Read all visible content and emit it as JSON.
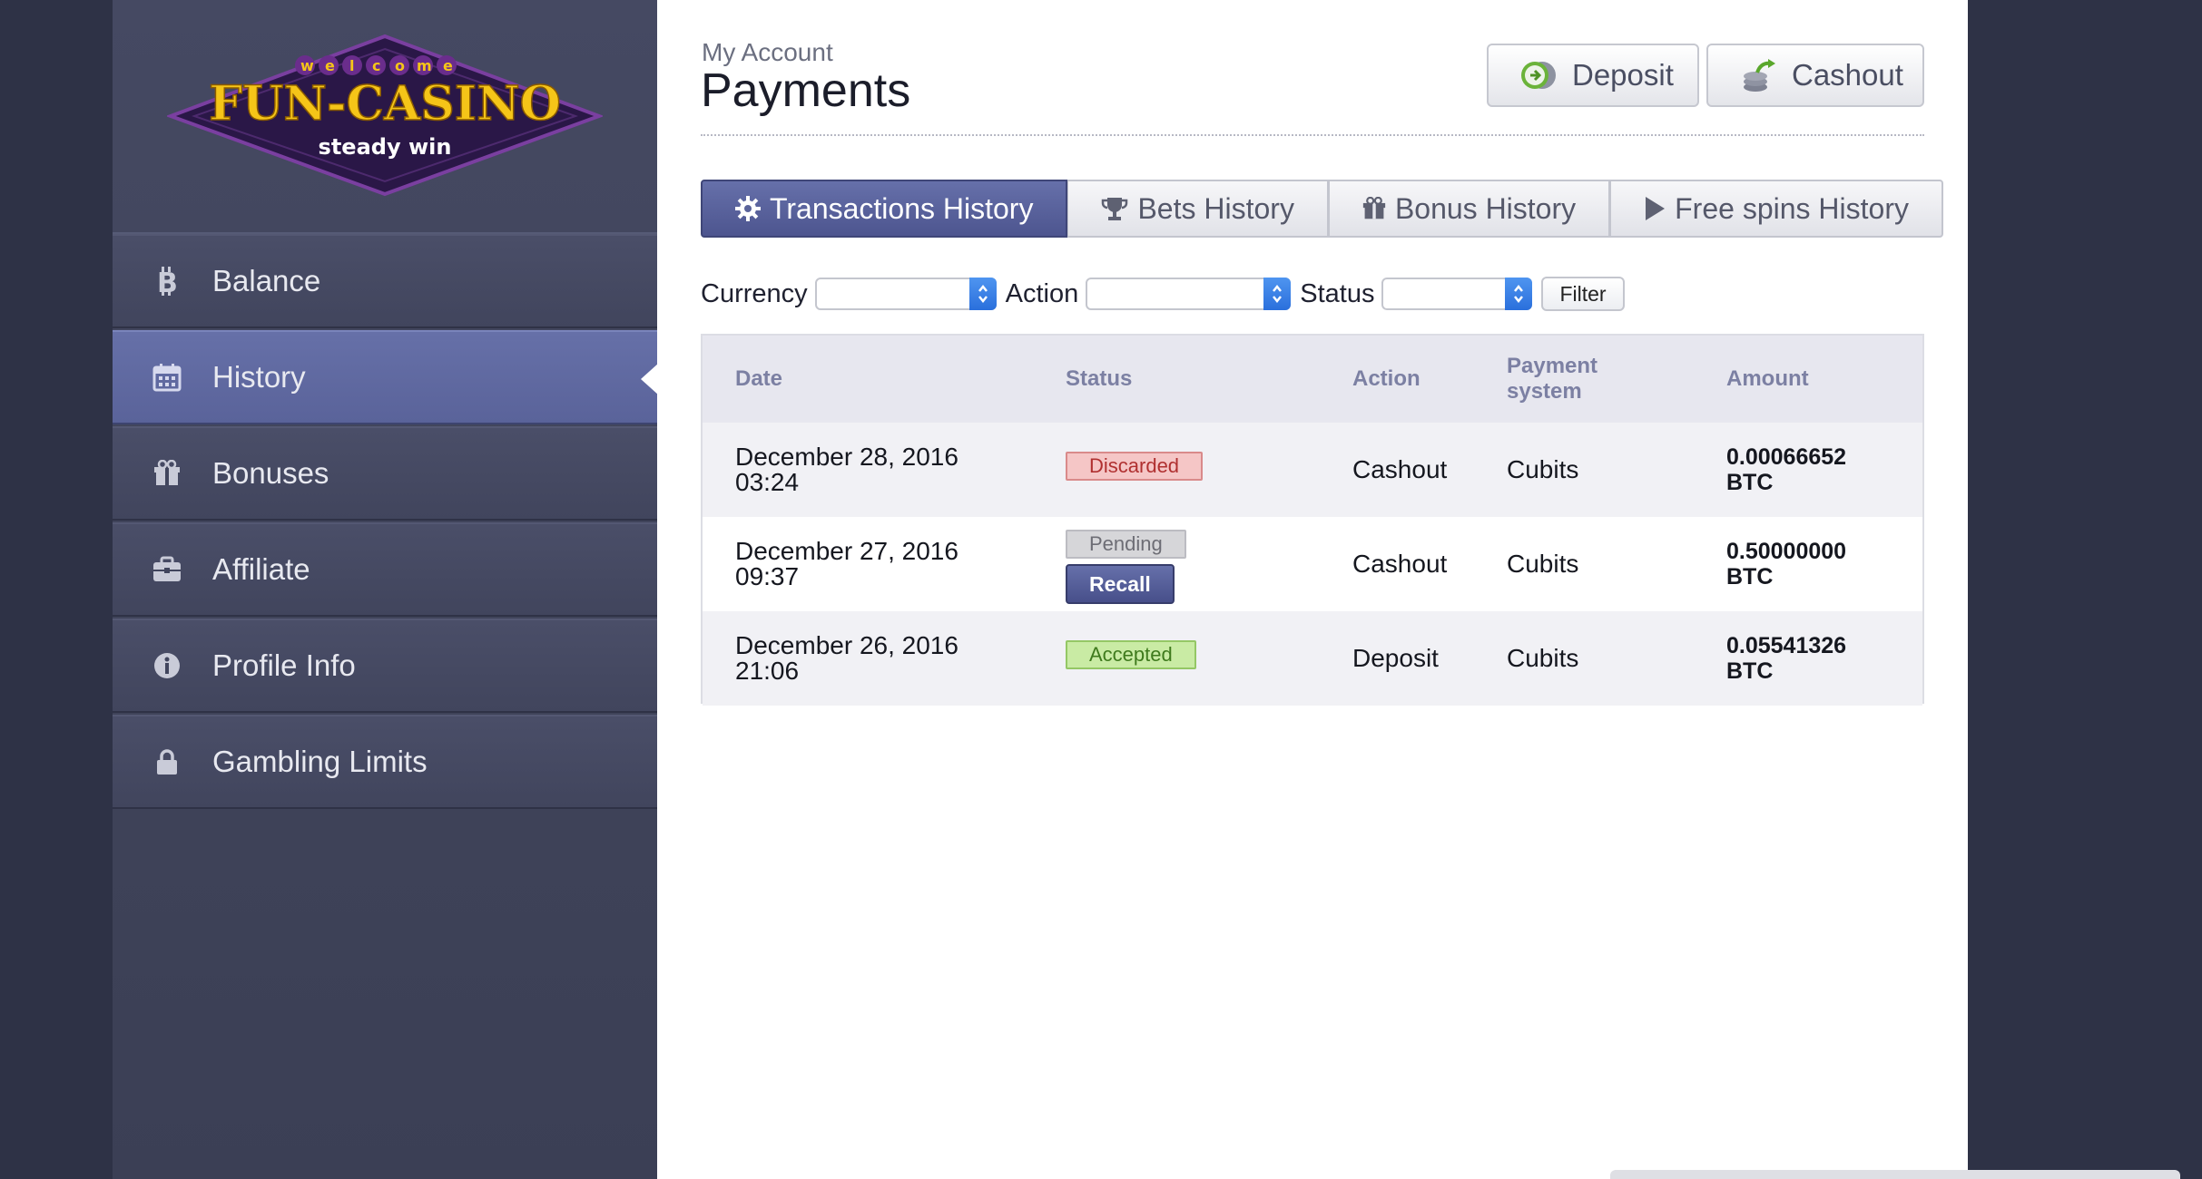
{
  "logo": {
    "welcome": "welcome",
    "brand": "FUN-CASINO",
    "tagline": "steady win"
  },
  "sidebar": {
    "items": [
      {
        "label": "Balance",
        "icon": "bitcoin-icon"
      },
      {
        "label": "History",
        "icon": "calendar-icon",
        "active": true
      },
      {
        "label": "Bonuses",
        "icon": "gift-icon"
      },
      {
        "label": "Affiliate",
        "icon": "briefcase-icon"
      },
      {
        "label": "Profile Info",
        "icon": "info-icon"
      },
      {
        "label": "Gambling Limits",
        "icon": "lock-icon"
      }
    ]
  },
  "header": {
    "breadcrumb": "My Account",
    "title": "Payments",
    "deposit_label": "Deposit",
    "cashout_label": "Cashout"
  },
  "tabs": [
    {
      "label": "Transactions History",
      "icon": "gear-icon",
      "active": true
    },
    {
      "label": "Bets History",
      "icon": "trophy-icon"
    },
    {
      "label": "Bonus History",
      "icon": "gift-icon"
    },
    {
      "label": "Free spins History",
      "icon": "play-icon"
    }
  ],
  "filters": {
    "currency_label": "Currency",
    "currency_value": "",
    "action_label": "Action",
    "action_value": "",
    "status_label": "Status",
    "status_value": "",
    "filter_button": "Filter"
  },
  "table": {
    "columns": [
      "Date",
      "Status",
      "Action",
      "Payment\nsystem",
      "Amount"
    ],
    "rows": [
      {
        "date": "December 28, 2016",
        "time": "03:24",
        "status": "Discarded",
        "action": "Cashout",
        "payment_system": "Cubits",
        "amount": "0.00066652",
        "currency": "BTC"
      },
      {
        "date": "December 27, 2016",
        "time": "09:37",
        "status": "Pending",
        "recall": "Recall",
        "action": "Cashout",
        "payment_system": "Cubits",
        "amount": "0.50000000",
        "currency": "BTC"
      },
      {
        "date": "December 26, 2016",
        "time": "21:06",
        "status": "Accepted",
        "action": "Deposit",
        "payment_system": "Cubits",
        "amount": "0.05541326",
        "currency": "BTC"
      }
    ]
  },
  "colors": {
    "sidebar_bg": "#41455d",
    "active_accent": "#5a639a",
    "discarded": "#b03030",
    "pending": "#6d6d75",
    "accepted": "#3f7a1d",
    "brand_gold": "#f5c518",
    "brand_purple": "#2a1747"
  }
}
